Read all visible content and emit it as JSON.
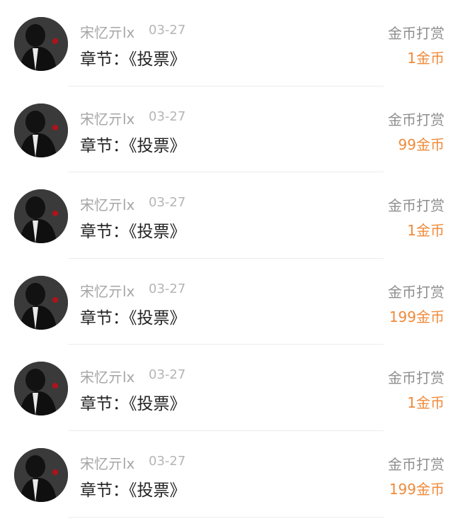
{
  "entries": [
    {
      "username": "宋忆亓lx",
      "date": "03-27",
      "chapter": "章节：《投票》",
      "type": "金币打赏",
      "amount": "1金币"
    },
    {
      "username": "宋忆亓lx",
      "date": "03-27",
      "chapter": "章节：《投票》",
      "type": "金币打赏",
      "amount": "99金币"
    },
    {
      "username": "宋忆亓lx",
      "date": "03-27",
      "chapter": "章节：《投票》",
      "type": "金币打赏",
      "amount": "1金币"
    },
    {
      "username": "宋忆亓lx",
      "date": "03-27",
      "chapter": "章节：《投票》",
      "type": "金币打赏",
      "amount": "199金币"
    },
    {
      "username": "宋忆亓lx",
      "date": "03-27",
      "chapter": "章节：《投票》",
      "type": "金币打赏",
      "amount": "1金币"
    },
    {
      "username": "宋忆亓lx",
      "date": "03-27",
      "chapter": "章节：《投票》",
      "type": "金币打赏",
      "amount": "199金币"
    }
  ],
  "colors": {
    "amount": "#f08a3a",
    "muted": "#a6a6a6",
    "chapter_text": "#222222"
  },
  "icons": {
    "avatar": "user-avatar-photo"
  }
}
